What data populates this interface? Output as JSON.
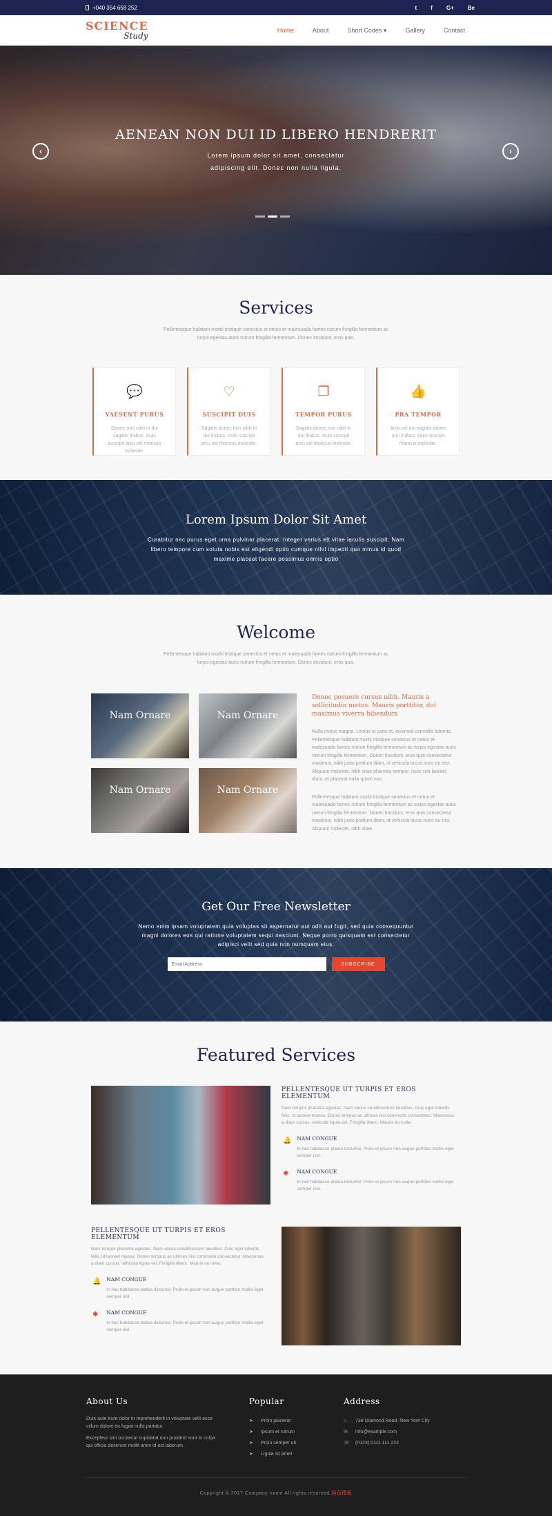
{
  "topbar": {
    "phone": "+040 354 658 252",
    "social": [
      "t",
      "f",
      "G+",
      "Be"
    ]
  },
  "nav": {
    "logo_line1": "SCIENCE",
    "logo_line2": "Study",
    "items": [
      "Home",
      "About",
      "Short Codes ▾",
      "Gallery",
      "Contact"
    ],
    "active": "Home"
  },
  "hero": {
    "title": "AENEAN NON DUI ID LIBERO HENDRERIT",
    "text_line1": "Lorem ipsum dolor sit amet, consectetur",
    "text_line2": "adipiscing elit. Donec non nulla ligula.",
    "prev_arrow": "‹",
    "next_arrow": "›"
  },
  "services": {
    "title": "Services",
    "subtitle": "Pellentesque habitant morbi tristique senectus et netus et malesuada fames rutrum fringilla fermentum ac turpis egestas auris rutrum fringilla fermentum. Donec tincidunt, eros quis.",
    "cards": [
      {
        "icon": "speech-bubble-icon",
        "glyph": "💬",
        "title": "VAESENT PURUS",
        "text": "Donec non nibh in dui sagittis finibus. Duis suscipit arcu vel rhoncus molestie."
      },
      {
        "icon": "heart-icon",
        "glyph": "♡",
        "title": "SUSCIPIT DUIS",
        "text": "Sagittis donec non nibh in dui finibus. Duis suscipit arcu vel rhoncus molestie."
      },
      {
        "icon": "copy-icon",
        "glyph": "❐",
        "title": "TEMPOR PURUS",
        "text": "Sagittis donec non nibh in dui finibus. Duis suscipit arcu vel rhoncus molestie."
      },
      {
        "icon": "thumbs-up-icon",
        "glyph": "👍",
        "title": "PRA TEMPOR",
        "text": "Arcu vel dui sagittis donec non finibus. Duis suscipit rhoncus molestie."
      }
    ]
  },
  "banner": {
    "title": "Lorem Ipsum Dolor Sit Amet",
    "text": "Curabitur nec purus eget urna pulvinar placerat. Integer verius elt vitae iaculis suscipit. Nam libero tempore cum soluta nobis est eligendi optio cumque nihil impedit quo minus id quod maxime placeat facere possimus omnis optio"
  },
  "welcome": {
    "title": "Welcome",
    "subtitle": "Pellentesque habitant morbi tristique senectus et netus et malesuada fames rutrum fringilla fermentum ac turpis egestas auris rutrum fringilla fermentum. Donec tincidunt, eros quis.",
    "tiles": [
      "Nam Ornare",
      "Nam Ornare",
      "Nam Ornare",
      "Nam Ornare"
    ],
    "heading": "Donec posuere cursus nibh. Mauris a sollicitudin metus. Mauris porttitor, dui maximus viverra bibendum",
    "para1": "Nulla metus magna. Lectus ut justo et, euismod convallis lobortis. Pellentesque habitant morbi tristique senectus et netus et malesuada fames rutrum fringilla fermentum ac turpis egestas auris rutrum fringilla fermentum. Donec tincidunt, eros quis consectetur maximus, nibh justo pretium diam, id vehicula lacus nunc eu orci. Aliquam molestie, nibh vitae pharetra semper, nunc nisi laoreet diam, et placerat nulla quam non.",
    "para2": "Pellentesque habitant morbi tristique senectus et netus et malesuada fames rutrum fringilla fermentum ac turpis egestas auris rutrum fringilla fermentum. Donec tincidunt, eros quis consectetur maximus, nibh justo pretium diam, id vehicula lacus nunc eu orci. Aliquam molestie, nibh vitae ."
  },
  "newsletter": {
    "title": "Get Our Free Newsletter",
    "text": "Nemo enim ipsam voluptatem quia voluptas sit aspernatur aut odit aut fugit, sed quia consequuntur magni dolores eos qui ratione voluptatem sequi nesciunt. Neque porro quisquam est consectetur adipisci velit sed quia non numquam eius.",
    "placeholder": "Email Address",
    "button": "SUBSCRIBE"
  },
  "featured": {
    "title": "Featured Services",
    "blocks": [
      {
        "heading": "PELLENTESQUE UT TURPIS ET EROS ELEMENTUM",
        "text": "Nam tempor pharetra egestas. Nam varius condimentum faucibus. Duis eget lobortis felis, id laoreet massa. Donec tempus ac ultrices nisi commodo consectetur. Maecenas a diam cursus, vehicula ligula vel. Fringilla libero. Mauris eu nulla.",
        "items": [
          {
            "title": "NAM CONGUE",
            "text": "In hac habitasse platea dictumst. Proin et ipsum non augue porttitor mollis eget semper nisl."
          },
          {
            "title": "NAM CONGUE",
            "text": "In hac habitasse platea dictumst. Proin et ipsum non augue porttitor mollis eget semper nisl."
          }
        ]
      },
      {
        "heading": "PELLENTESQUE UT TURPIS ET EROS ELEMENTUM",
        "text": "Nam tempor pharetra egestas. Nam varius condimentum faucibus. Duis eget lobortis felis, id laoreet massa. Donec tempus ac ultrices nisi commodo consectetur. Maecenas a diam cursus, vehicula ligula vel. Fringilla libero. Mauris eu nulla.",
        "items": [
          {
            "title": "NAM CONGUE",
            "text": "In hac habitasse platea dictumst. Proin et ipsum non augue porttitor mollis eget semper nisl."
          },
          {
            "title": "NAM CONGUE",
            "text": "In hac habitasse platea dictumst. Proin et ipsum non augue porttitor mollis eget semper nisl."
          }
        ]
      }
    ]
  },
  "footer": {
    "about_title": "About Us",
    "about_p1": "Duis aute irure dolor in reprehenderit in voluptate velit esse cillum dolore eu fugiat nulla pariatur.",
    "about_p2": "Excepteur sint occaecat cupidatat non proident sunt in culpa qui officia deserunt mollit anim id est laborum.",
    "popular_title": "Popular",
    "popular": [
      "Proin placerat",
      "Ipsum et rutrum",
      "Proin semper uti",
      "Ligula sit amet"
    ],
    "address_title": "Address",
    "address": [
      {
        "icon": "home-icon",
        "glyph": "⌂",
        "text": "738 Diamond Road, New York City"
      },
      {
        "icon": "mail-icon",
        "glyph": "✉",
        "text": "info@example.com"
      },
      {
        "icon": "phone-icon",
        "glyph": "☏",
        "text": "(0123) 0111 111 222"
      }
    ],
    "copyright": "Copyright © 2017.Company name All rights reserved.",
    "copyright_link": "网页模板"
  }
}
